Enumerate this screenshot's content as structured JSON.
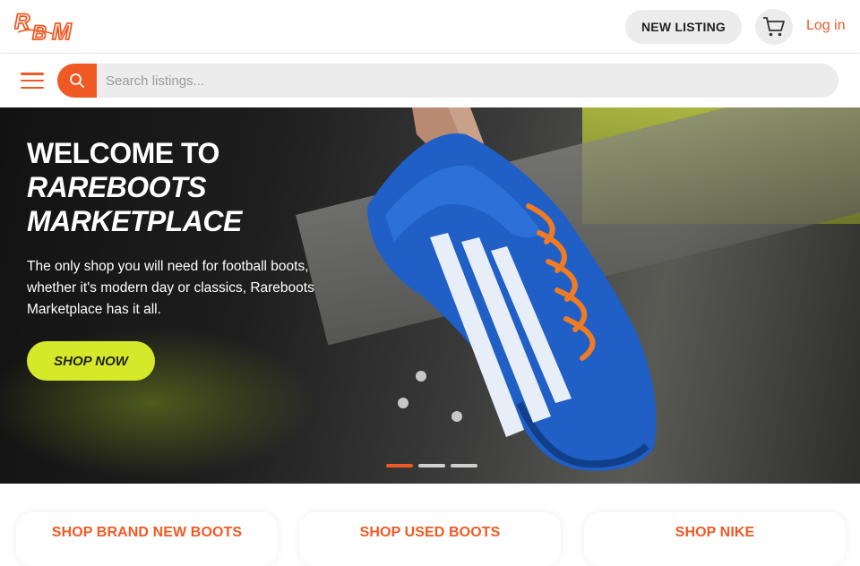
{
  "header": {
    "logo_text": "RBM",
    "new_listing_label": "NEW LISTING",
    "cart_icon": "cart-icon",
    "login_label": "Log in"
  },
  "search": {
    "placeholder": "Search listings...",
    "menu_icon": "hamburger-icon",
    "search_icon": "search-icon"
  },
  "hero": {
    "title_line1": "WELCOME TO",
    "title_line2": "RAREBOOTS",
    "title_line3": "MARKETPLACE",
    "description": "The only shop you will need for football boots, whether it's modern day or classics, Rareboots Marketplace has it all.",
    "cta_label": "SHOP NOW",
    "slides": 3,
    "active_slide": 1
  },
  "categories": [
    {
      "label": "SHOP BRAND NEW BOOTS"
    },
    {
      "label": "SHOP USED BOOTS"
    },
    {
      "label": "SHOP NIKE"
    }
  ],
  "colors": {
    "accent": "#ef5a24",
    "cta": "#d6e82a",
    "pill_bg": "#ececec"
  }
}
